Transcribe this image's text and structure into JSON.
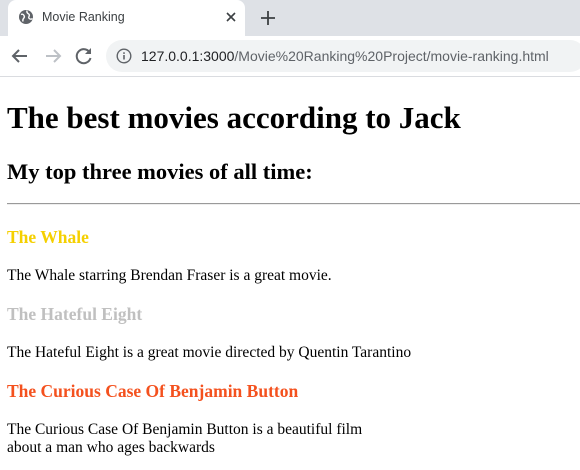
{
  "browser": {
    "tab": {
      "title": "Movie Ranking",
      "favicon": "globe-icon"
    },
    "address": {
      "host": "127.0.0.1:3000",
      "path": "/Movie%20Ranking%20Project/movie-ranking.html"
    }
  },
  "page": {
    "heading": "The best movies according to Jack",
    "subheading": "My top three movies of all time:",
    "movies": [
      {
        "title": "The Whale",
        "color": "#f5d000",
        "description": [
          "The Whale starring Brendan Fraser is a great movie."
        ]
      },
      {
        "title": "The Hateful Eight",
        "color": "#c0c0c0",
        "description": [
          "The Hateful Eight is a great movie directed by Quentin Tarantino"
        ]
      },
      {
        "title": "The Curious Case Of Benjamin Button",
        "color": "#f4511e",
        "description": [
          "The Curious Case Of Benjamin Button is a beautiful film",
          "about a man who ages backwards"
        ]
      }
    ]
  },
  "colors": {
    "tabstrip": "#dee1e6",
    "omnibox": "#f1f3f4"
  }
}
